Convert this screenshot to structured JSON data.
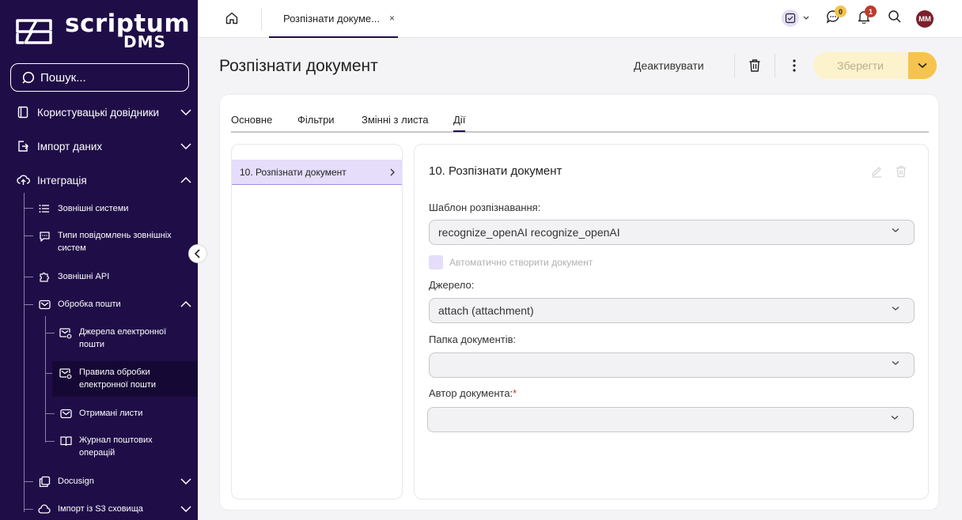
{
  "app": {
    "logo_word1": "scriptum",
    "logo_word2": "DMS",
    "search_placeholder": "Пошук..."
  },
  "sidebar": {
    "items": [
      {
        "label": "Користувацькі довідники",
        "icon": "book-icon"
      },
      {
        "label": "Імпорт даних",
        "icon": "import-icon"
      },
      {
        "label": "Інтеграція",
        "icon": "cloud-upload-icon"
      },
      {
        "label": "Зовнішні системи",
        "icon": "list-icon"
      },
      {
        "label": "Типи повідомлень зовнішніх систем",
        "icon": "message-icon"
      },
      {
        "label": "Зовнішні API",
        "icon": "puzzle-icon"
      },
      {
        "label": "Обробка пошти",
        "icon": "mail-icon"
      },
      {
        "label": "Джерела електронної пошти",
        "icon": "mail-settings-icon"
      },
      {
        "label": "Правила обробки електронної пошти",
        "icon": "mail-rules-icon"
      },
      {
        "label": "Отримані листи",
        "icon": "mail-icon"
      },
      {
        "label": "Журнал поштових операцій",
        "icon": "journal-icon"
      },
      {
        "label": "Docusign",
        "icon": "docusign-icon"
      },
      {
        "label": "Імпорт із S3 сховища",
        "icon": "cloud-icon"
      }
    ]
  },
  "topbar": {
    "tab_label": "Розпізнати докуме...",
    "close_symbol": "×",
    "chat_badge": "0",
    "notif_badge": "1",
    "avatar_initials": "MM"
  },
  "header": {
    "title": "Розпізнати документ",
    "deactivate_label": "Деактивувати",
    "save_label": "Зберегти"
  },
  "tabs": [
    {
      "label": "Основне"
    },
    {
      "label": "Фільтри"
    },
    {
      "label": "Змінні з листа"
    },
    {
      "label": "Дії"
    }
  ],
  "action_list": {
    "items": [
      {
        "label": "10. Розпізнати документ"
      }
    ]
  },
  "form": {
    "title": "10. Розпізнати документ",
    "template_label": "Шаблон розпізнавання:",
    "template_value": "recognize_openAI recognize_openAI",
    "auto_create_label": "Автоматично створити документ",
    "source_label": "Джерело:",
    "source_value": "attach (attachment)",
    "folder_label": "Папка документів:",
    "folder_value": "",
    "author_label": "Автор документа:",
    "required_mark": "*",
    "author_value": ""
  },
  "colors": {
    "sidebar_bg": "#1f0d47",
    "accent_yellow": "#f6c44e",
    "save_disabled_bg": "#fcf2cc",
    "selection_bg": "#e5ddf9",
    "chat_badge": "#f3c34a",
    "notif_badge": "#c0392b",
    "avatar_bg": "#7a1f2b"
  }
}
